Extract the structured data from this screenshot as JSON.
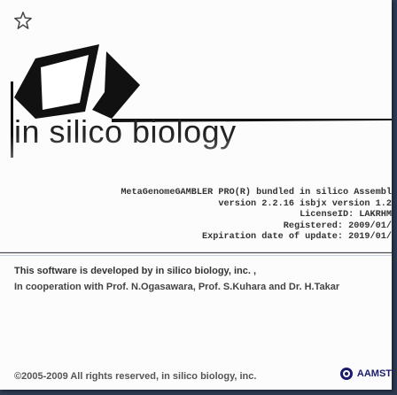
{
  "logo": {
    "title": "in silico biology"
  },
  "info": {
    "product_line": "MetaGenomeGAMBLER PRO(R)  bundled  in silico  Assembl",
    "version_line": "version 2.2.16  isbjx version 1.2",
    "license_line": "LicenseID:  LAKRHM",
    "registered_line": "Registered:  2009/01/",
    "expiration_line": "Expiration date of update:  2019/01/"
  },
  "credits": {
    "developer_line": "This software is developed by in silico biology, inc. ,",
    "cooperation_line": "In cooperation with Prof. N.Ogasawara, Prof. S.Kuhara and Dr. H.Takar"
  },
  "footer": {
    "copyright": "©2005-2009 All rights reserved, in silico biology, inc.",
    "partner_logo": "AAMST"
  },
  "colors": {
    "background": "#2c3a52",
    "panel": "#fcfcfc",
    "partner_logo_text": "#1a1a6e"
  },
  "icons": {
    "top_left": "star-icon",
    "partner": "amst-icon"
  }
}
